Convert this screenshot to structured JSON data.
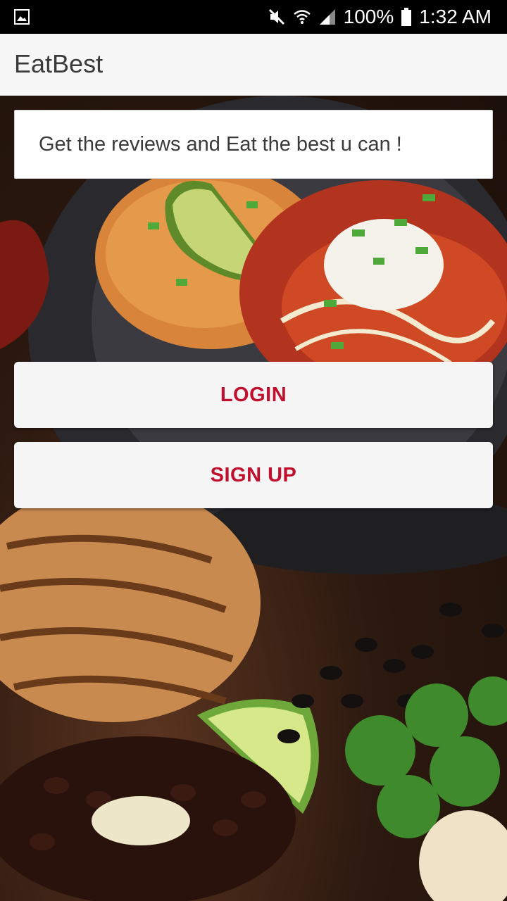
{
  "status_bar": {
    "battery": "100%",
    "time": "1:32 AM",
    "icons": [
      "image-notification-icon",
      "mute-icon",
      "wifi-icon",
      "signal-icon",
      "battery-icon"
    ]
  },
  "app_bar": {
    "title": "EatBest"
  },
  "main": {
    "tagline": "Get the reviews and Eat the best u can !",
    "login_label": "LOGIN",
    "signup_label": "SIGN UP"
  },
  "colors": {
    "accent": "#c0102e",
    "app_bar_bg": "#f7f7f7",
    "button_bg": "#f5f5f5"
  }
}
